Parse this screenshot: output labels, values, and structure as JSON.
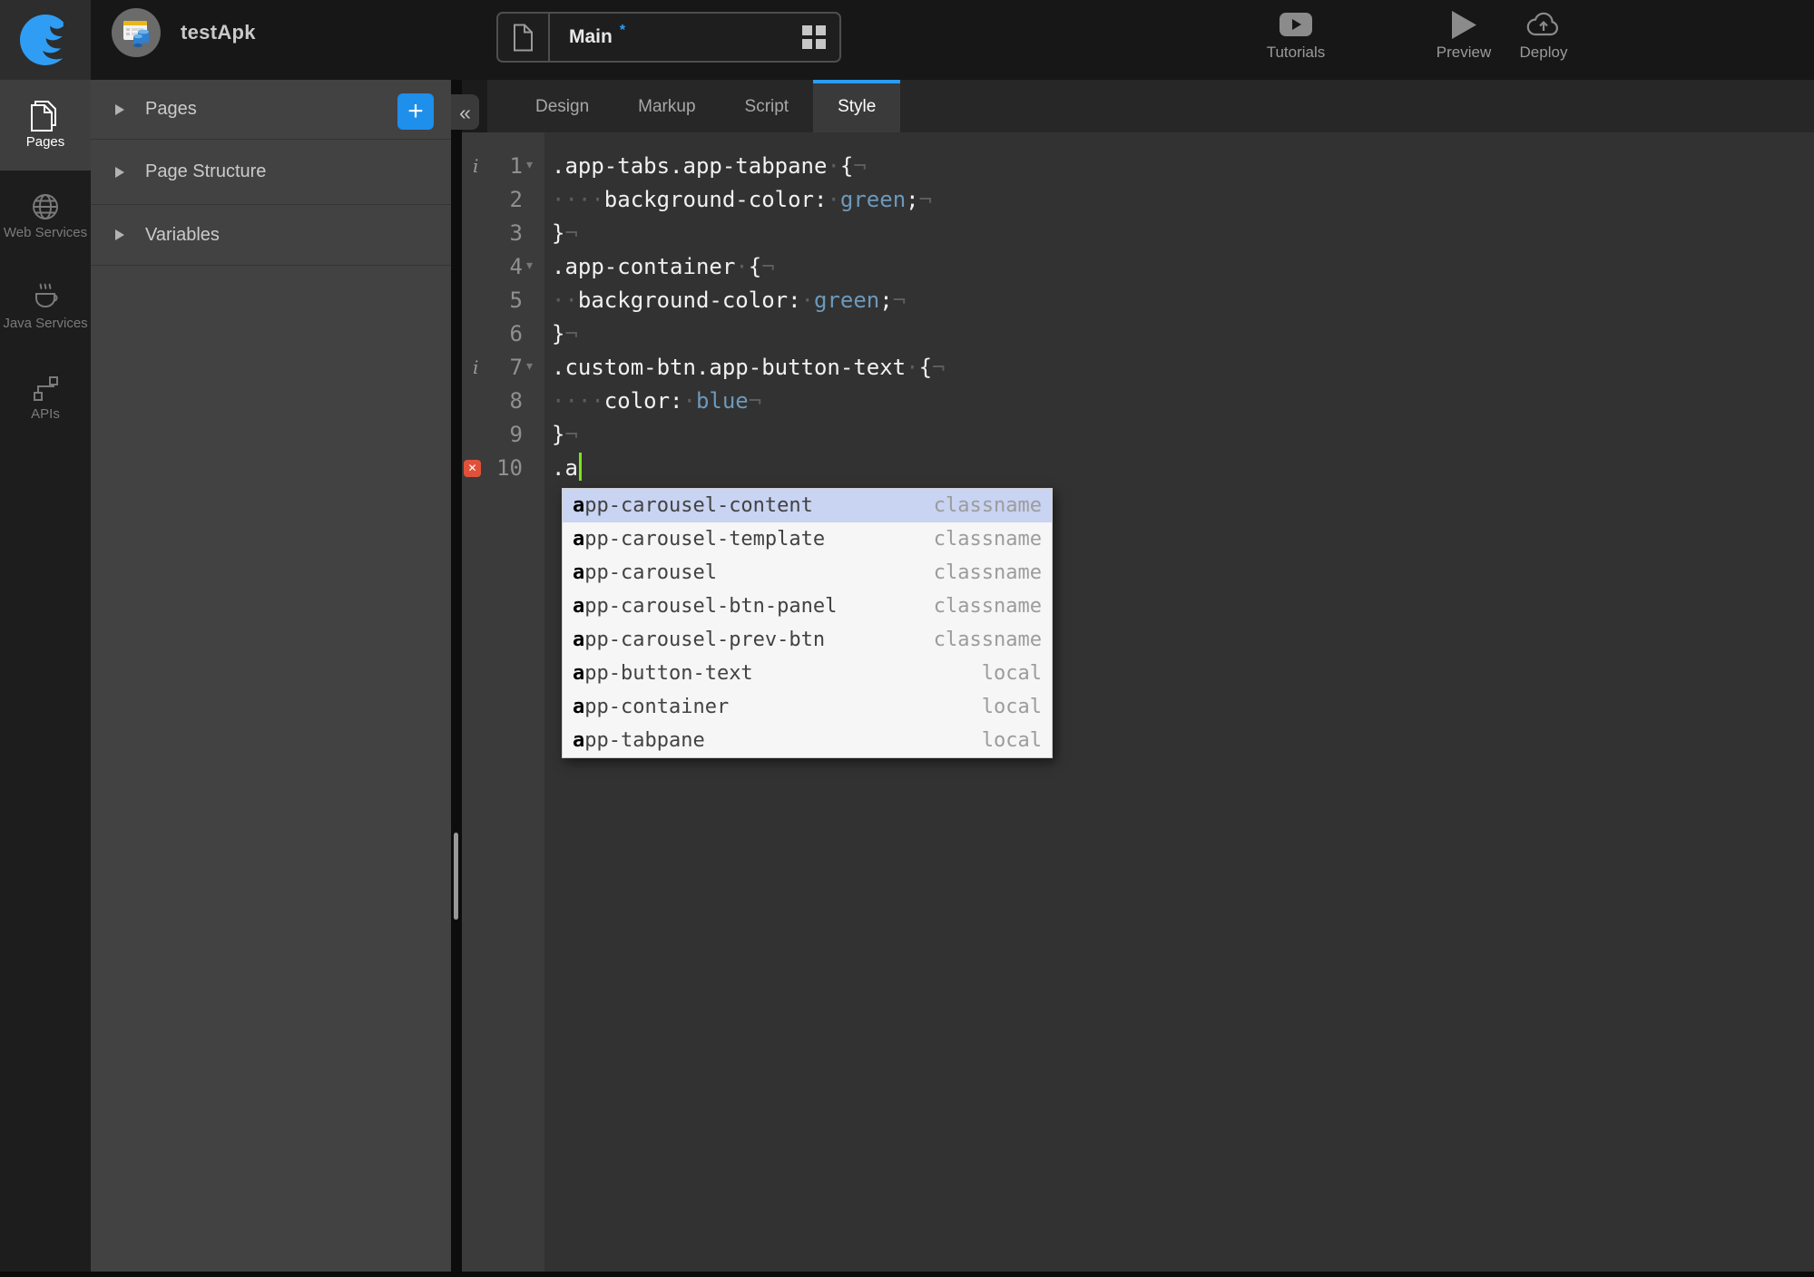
{
  "app": {
    "project_name": "testApk"
  },
  "topbar": {
    "page_tab": {
      "label": "Main",
      "dirty_marker": "*"
    },
    "actions": [
      {
        "label": "Tutorials",
        "icon": "youtube-icon"
      },
      {
        "label": "Preview",
        "icon": "play-icon"
      },
      {
        "label": "Deploy",
        "icon": "cloud-upload-icon"
      }
    ]
  },
  "side_nav": {
    "items": [
      {
        "label": "Pages",
        "icon": "pages-icon",
        "active": true
      },
      {
        "label": "Web Services",
        "icon": "globe-icon",
        "active": false
      },
      {
        "label": "Java Services",
        "icon": "coffee-icon",
        "active": false
      },
      {
        "label": "APIs",
        "icon": "api-nodes-icon",
        "active": false
      }
    ]
  },
  "left_panel": {
    "collapse_label": "«",
    "add_label": "+",
    "sections": [
      {
        "label": "Pages",
        "has_add_button": true
      },
      {
        "label": "Page Structure",
        "has_add_button": false
      },
      {
        "label": "Variables",
        "has_add_button": false
      }
    ]
  },
  "editor": {
    "tabs": [
      {
        "label": "Design",
        "active": false
      },
      {
        "label": "Markup",
        "active": false
      },
      {
        "label": "Script",
        "active": false
      },
      {
        "label": "Style",
        "active": true
      }
    ],
    "lines": [
      {
        "n": "1",
        "info": true,
        "fold": true,
        "error": false,
        "cursor": false,
        "tokens": [
          [
            "t",
            ".app-tabs.app-tabpane"
          ],
          [
            "w",
            "·"
          ],
          [
            "t",
            "{"
          ],
          [
            "w",
            "¬"
          ]
        ]
      },
      {
        "n": "2",
        "info": false,
        "fold": false,
        "error": false,
        "cursor": false,
        "tokens": [
          [
            "w",
            "····"
          ],
          [
            "t",
            "background-color:"
          ],
          [
            "w",
            "·"
          ],
          [
            "v",
            "green"
          ],
          [
            "t",
            ";"
          ],
          [
            "w",
            "¬"
          ]
        ]
      },
      {
        "n": "3",
        "info": false,
        "fold": false,
        "error": false,
        "cursor": false,
        "tokens": [
          [
            "t",
            "}"
          ],
          [
            "w",
            "¬"
          ]
        ]
      },
      {
        "n": "4",
        "info": false,
        "fold": true,
        "error": false,
        "cursor": false,
        "tokens": [
          [
            "t",
            ".app-container"
          ],
          [
            "w",
            "·"
          ],
          [
            "t",
            "{"
          ],
          [
            "w",
            "¬"
          ]
        ]
      },
      {
        "n": "5",
        "info": false,
        "fold": false,
        "error": false,
        "cursor": false,
        "tokens": [
          [
            "w",
            "··"
          ],
          [
            "t",
            "background-color:"
          ],
          [
            "w",
            "·"
          ],
          [
            "v",
            "green"
          ],
          [
            "t",
            ";"
          ],
          [
            "w",
            "¬"
          ]
        ]
      },
      {
        "n": "6",
        "info": false,
        "fold": false,
        "error": false,
        "cursor": false,
        "tokens": [
          [
            "t",
            "}"
          ],
          [
            "w",
            "¬"
          ]
        ]
      },
      {
        "n": "7",
        "info": true,
        "fold": true,
        "error": false,
        "cursor": false,
        "tokens": [
          [
            "t",
            ".custom-btn.app-button-text"
          ],
          [
            "w",
            "·"
          ],
          [
            "t",
            "{"
          ],
          [
            "w",
            "¬"
          ]
        ]
      },
      {
        "n": "8",
        "info": false,
        "fold": false,
        "error": false,
        "cursor": false,
        "tokens": [
          [
            "w",
            "····"
          ],
          [
            "t",
            "color:"
          ],
          [
            "w",
            "·"
          ],
          [
            "v",
            "blue"
          ],
          [
            "w",
            "¬"
          ]
        ]
      },
      {
        "n": "9",
        "info": false,
        "fold": false,
        "error": false,
        "cursor": false,
        "tokens": [
          [
            "t",
            "}"
          ],
          [
            "w",
            "¬"
          ]
        ]
      },
      {
        "n": "10",
        "info": false,
        "fold": false,
        "error": true,
        "cursor": true,
        "tokens": [
          [
            "t",
            ".a"
          ]
        ]
      }
    ]
  },
  "autocomplete": {
    "items": [
      {
        "label": "app-carousel-content",
        "meta": "classname",
        "selected": true
      },
      {
        "label": "app-carousel-template",
        "meta": "classname",
        "selected": false
      },
      {
        "label": "app-carousel",
        "meta": "classname",
        "selected": false
      },
      {
        "label": "app-carousel-btn-panel",
        "meta": "classname",
        "selected": false
      },
      {
        "label": "app-carousel-prev-btn",
        "meta": "classname",
        "selected": false
      },
      {
        "label": "app-button-text",
        "meta": "local",
        "selected": false
      },
      {
        "label": "app-container",
        "meta": "local",
        "selected": false
      },
      {
        "label": "app-tabpane",
        "meta": "local",
        "selected": false
      }
    ]
  },
  "colors": {
    "accent_blue": "#2b9cf2",
    "css_value": "#6c99bb",
    "cursor_green": "#7be41e",
    "error_red": "#e0513a",
    "selected_suggestion_bg": "#c9d3f2"
  }
}
